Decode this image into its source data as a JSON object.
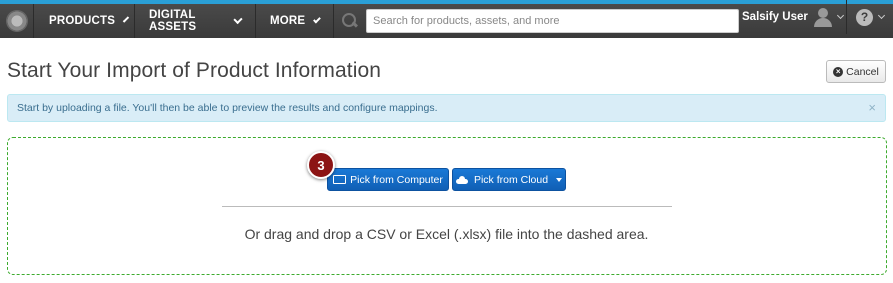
{
  "topbar": {
    "accent_color": "#2a9fd6",
    "nav": [
      {
        "label": "PRODUCTS"
      },
      {
        "label": "DIGITAL ASSETS"
      },
      {
        "label": "MORE"
      }
    ],
    "search_placeholder": "Search for products, assets, and more",
    "user_name": "Salsify User",
    "help_glyph": "?"
  },
  "page": {
    "title": "Start Your Import of Product Information",
    "cancel_label": "Cancel"
  },
  "alert": {
    "text": "Start by uploading a file. You'll then be able to preview the results and configure mappings.",
    "close_glyph": "×"
  },
  "dropzone": {
    "step_number": "3",
    "pick_computer_label": "Pick from Computer",
    "pick_cloud_label": "Pick from Cloud",
    "drop_text": "Or drag and drop a CSV or Excel (.xlsx) file into the dashed area.",
    "border_color": "#3dab2e"
  }
}
